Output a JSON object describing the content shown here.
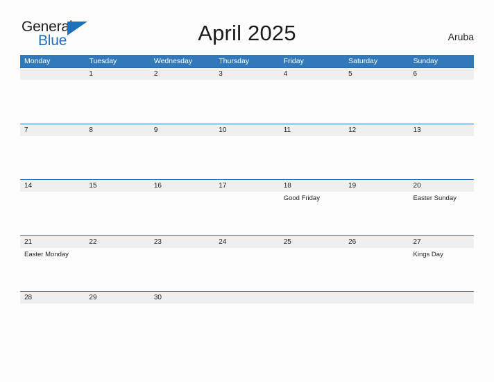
{
  "brand": {
    "name_part1": "General",
    "name_part2": "Blue",
    "triangle_icon": "triangle-icon",
    "accent_color": "#1c71bd"
  },
  "header": {
    "title": "April 2025",
    "country": "Aruba"
  },
  "colors": {
    "weekday_header_bg": "#3279bc",
    "weekday_header_text": "#ffffff",
    "day_band_bg": "#efefef",
    "row_divider": "#2a6bab",
    "page_bg": "#fdfdfd"
  },
  "calendar": {
    "weekdays": [
      "Monday",
      "Tuesday",
      "Wednesday",
      "Thursday",
      "Friday",
      "Saturday",
      "Sunday"
    ],
    "weeks": [
      {
        "days": [
          {
            "date": "",
            "event": ""
          },
          {
            "date": "1",
            "event": ""
          },
          {
            "date": "2",
            "event": ""
          },
          {
            "date": "3",
            "event": ""
          },
          {
            "date": "4",
            "event": ""
          },
          {
            "date": "5",
            "event": ""
          },
          {
            "date": "6",
            "event": ""
          }
        ]
      },
      {
        "days": [
          {
            "date": "7",
            "event": ""
          },
          {
            "date": "8",
            "event": ""
          },
          {
            "date": "9",
            "event": ""
          },
          {
            "date": "10",
            "event": ""
          },
          {
            "date": "11",
            "event": ""
          },
          {
            "date": "12",
            "event": ""
          },
          {
            "date": "13",
            "event": ""
          }
        ]
      },
      {
        "days": [
          {
            "date": "14",
            "event": ""
          },
          {
            "date": "15",
            "event": ""
          },
          {
            "date": "16",
            "event": ""
          },
          {
            "date": "17",
            "event": ""
          },
          {
            "date": "18",
            "event": "Good Friday"
          },
          {
            "date": "19",
            "event": ""
          },
          {
            "date": "20",
            "event": "Easter Sunday"
          }
        ]
      },
      {
        "days": [
          {
            "date": "21",
            "event": "Easter Monday"
          },
          {
            "date": "22",
            "event": ""
          },
          {
            "date": "23",
            "event": ""
          },
          {
            "date": "24",
            "event": ""
          },
          {
            "date": "25",
            "event": ""
          },
          {
            "date": "26",
            "event": ""
          },
          {
            "date": "27",
            "event": "Kings Day"
          }
        ]
      },
      {
        "days": [
          {
            "date": "28",
            "event": ""
          },
          {
            "date": "29",
            "event": ""
          },
          {
            "date": "30",
            "event": ""
          },
          {
            "date": "",
            "event": ""
          },
          {
            "date": "",
            "event": ""
          },
          {
            "date": "",
            "event": ""
          },
          {
            "date": "",
            "event": ""
          }
        ]
      }
    ]
  }
}
